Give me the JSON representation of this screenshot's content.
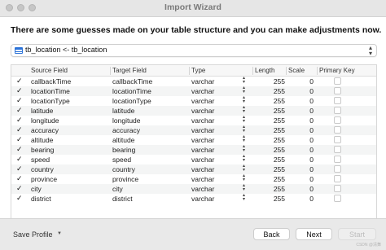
{
  "window": {
    "title": "Import Wizard"
  },
  "headline": "There are some guesses made on your table structure and you can make adjustments now.",
  "selector": {
    "value": "tb_location <- tb_location"
  },
  "table": {
    "headers": [
      "Source Field",
      "Target Field",
      "Type",
      "Length",
      "Scale",
      "Primary Key"
    ],
    "rows": [
      {
        "source": "callbackTime",
        "target": "callbackTime",
        "type": "varchar",
        "length": "255",
        "scale": "0"
      },
      {
        "source": "locationTime",
        "target": "locationTime",
        "type": "varchar",
        "length": "255",
        "scale": "0"
      },
      {
        "source": "locationType",
        "target": "locationType",
        "type": "varchar",
        "length": "255",
        "scale": "0"
      },
      {
        "source": "latitude",
        "target": "latitude",
        "type": "varchar",
        "length": "255",
        "scale": "0"
      },
      {
        "source": "longitude",
        "target": "longitude",
        "type": "varchar",
        "length": "255",
        "scale": "0"
      },
      {
        "source": "accuracy",
        "target": "accuracy",
        "type": "varchar",
        "length": "255",
        "scale": "0"
      },
      {
        "source": "altitude",
        "target": "altitude",
        "type": "varchar",
        "length": "255",
        "scale": "0"
      },
      {
        "source": "bearing",
        "target": "bearing",
        "type": "varchar",
        "length": "255",
        "scale": "0"
      },
      {
        "source": "speed",
        "target": "speed",
        "type": "varchar",
        "length": "255",
        "scale": "0"
      },
      {
        "source": "country",
        "target": "country",
        "type": "varchar",
        "length": "255",
        "scale": "0"
      },
      {
        "source": "province",
        "target": "province",
        "type": "varchar",
        "length": "255",
        "scale": "0"
      },
      {
        "source": "city",
        "target": "city",
        "type": "varchar",
        "length": "255",
        "scale": "0"
      },
      {
        "source": "district",
        "target": "district",
        "type": "varchar",
        "length": "255",
        "scale": "0"
      }
    ]
  },
  "footer": {
    "save_profile": "Save Profile",
    "back": "Back",
    "next": "Next",
    "start": "Start",
    "watermark": "CSDN @清舞"
  },
  "icons": {
    "checkbox_checked": "checkmark-icon",
    "stepper": "up-down-chevron-icon",
    "dropdown": "chevron-updown-icon",
    "table": "table-icon"
  }
}
